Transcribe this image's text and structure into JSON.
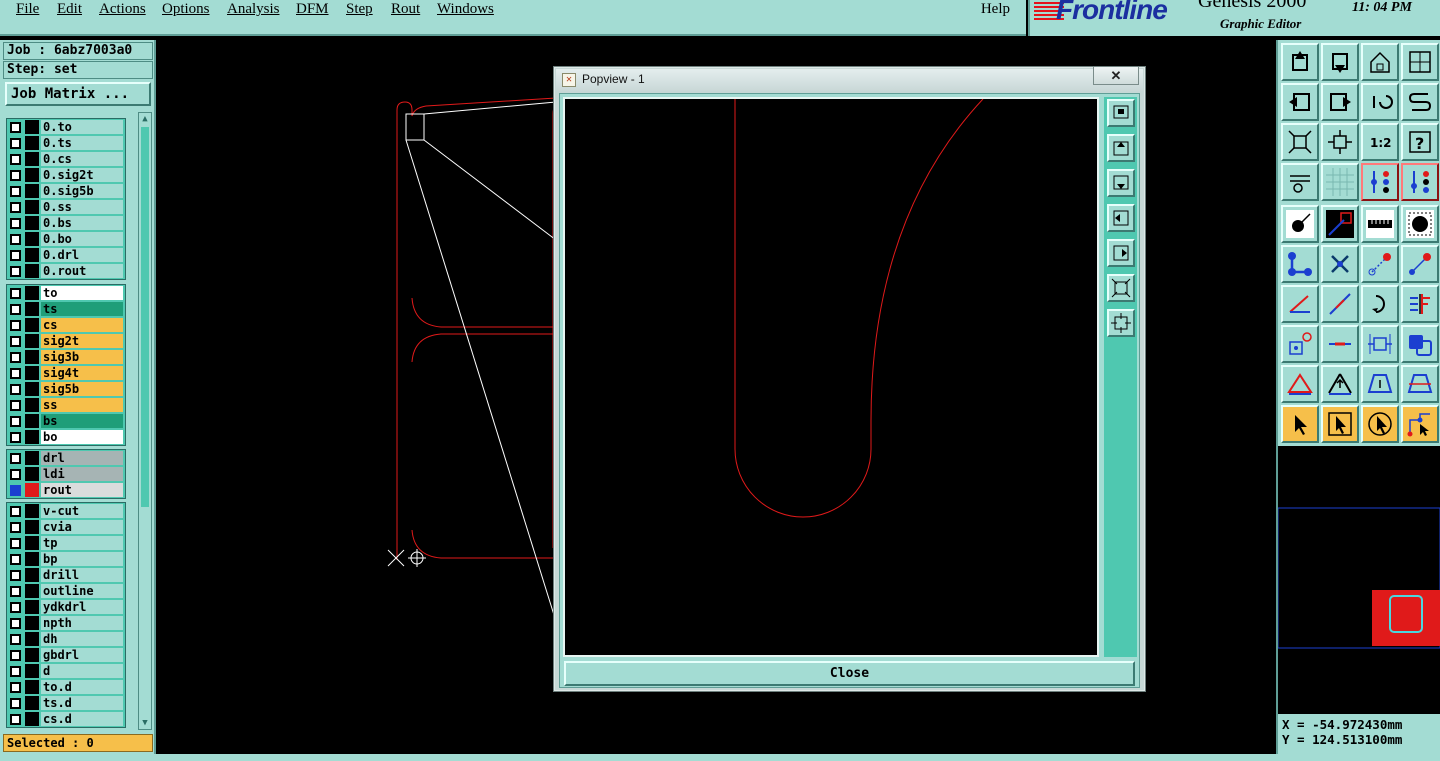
{
  "menu": {
    "items": [
      "File",
      "Edit",
      "Actions",
      "Options",
      "Analysis",
      "DFM",
      "Step",
      "Rout",
      "Windows"
    ],
    "help": "Help"
  },
  "brand": {
    "logo": "Frontline",
    "product": "Genesis 2000",
    "subtitle": "Graphic Editor",
    "clock": "11: 04  PM"
  },
  "job": {
    "job_line": "Job : 6abz7003a0",
    "step_line": "Step: set",
    "job_matrix_button": "Job Matrix ..."
  },
  "layers": {
    "group1": [
      "0.to",
      "0.ts",
      "0.cs",
      "0.sig2t",
      "0.sig5b",
      "0.ss",
      "0.bs",
      "0.bo",
      "0.drl",
      "0.rout"
    ],
    "group2": [
      {
        "name": "to",
        "color": "#ffffff"
      },
      {
        "name": "ts",
        "color": "#1f9e79"
      },
      {
        "name": "cs",
        "color": "#f6bf4a"
      },
      {
        "name": "sig2t",
        "color": "#f6bf4a"
      },
      {
        "name": "sig3b",
        "color": "#f6bf4a"
      },
      {
        "name": "sig4t",
        "color": "#f6bf4a"
      },
      {
        "name": "sig5b",
        "color": "#f6bf4a"
      },
      {
        "name": "ss",
        "color": "#f6bf4a"
      },
      {
        "name": "bs",
        "color": "#1f9e79"
      },
      {
        "name": "bo",
        "color": "#ffffff"
      }
    ],
    "group3": [
      {
        "name": "drl",
        "color": "#a6b4b4"
      },
      {
        "name": "ldi",
        "color": "#a6b4b4"
      },
      {
        "name": "rout",
        "color": "#d9dcdc",
        "active": true
      }
    ],
    "group4": [
      "v-cut",
      "cvia",
      "tp",
      "bp",
      "drill",
      "outline",
      "ydkdrl",
      "npth",
      "dh",
      "gbdrl",
      "d",
      "to.d",
      "ts.d",
      "cs.d"
    ]
  },
  "status": {
    "selected": "Selected : 0"
  },
  "popup": {
    "title": "Popview - 1",
    "close_x": "✕",
    "close_button": "Close"
  },
  "coordinates": {
    "x": "X = -54.972430mm",
    "y": "Y = 124.513100mm"
  },
  "colors": {
    "panel": "#a3dcd3",
    "panel_dark": "#4fc8b0",
    "profile_line": "#e01a1a",
    "accent_orange": "#f6bf4a"
  }
}
